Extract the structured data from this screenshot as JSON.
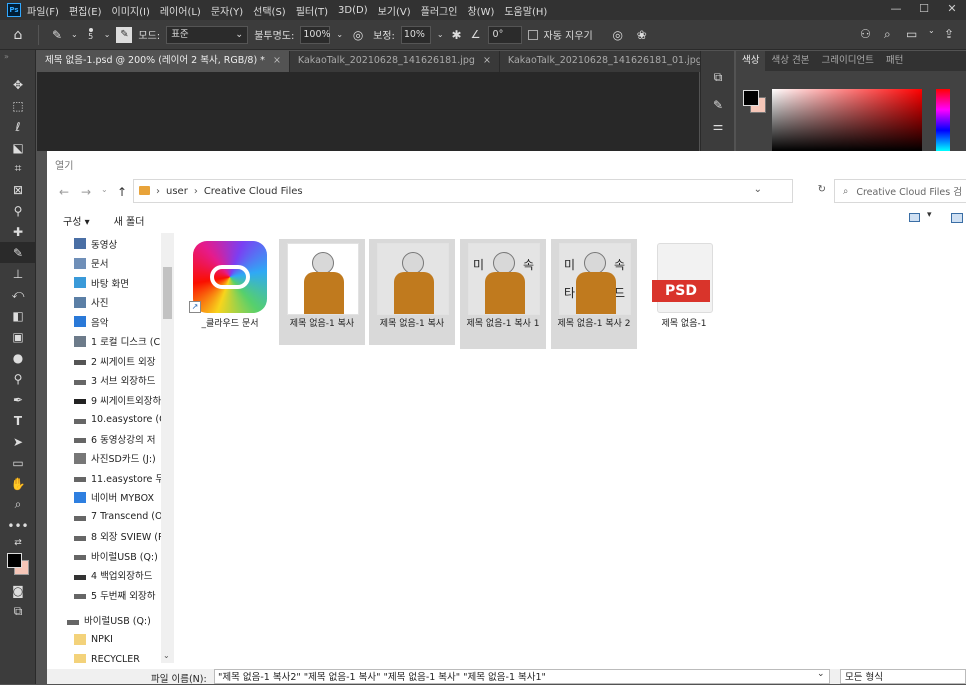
{
  "menubar": {
    "logo": "Ps",
    "items": [
      "파일(F)",
      "편집(E)",
      "이미지(I)",
      "레이어(L)",
      "문자(Y)",
      "선택(S)",
      "필터(T)",
      "3D(D)",
      "보기(V)",
      "플러그인",
      "창(W)",
      "도움말(H)"
    ]
  },
  "options": {
    "brush_size": "5",
    "mode_label": "모드:",
    "mode_value": "표준",
    "opacity_label": "불투명도:",
    "opacity_value": "100%",
    "smoothing_label": "보정:",
    "smoothing_value": "10%",
    "angle_value": "0°",
    "auto_erase_label": "자동 지우기"
  },
  "tabs": [
    {
      "label": "제목 없음-1.psd @ 200% (레이어 2 복사, RGB/8) *",
      "close": "×"
    },
    {
      "label": "KakaoTalk_20210628_141626181.jpg",
      "close": "×"
    },
    {
      "label": "KakaoTalk_20210628_141626181_01.jpg",
      "close": "×"
    }
  ],
  "color_panel": {
    "tabs": [
      "색상",
      "색상 견본",
      "그레이디언트",
      "패턴"
    ],
    "foreground": "#000000",
    "background": "#f5c6b8"
  },
  "dialog": {
    "title": "열기",
    "breadcrumb": [
      "user",
      "Creative Cloud Files"
    ],
    "search_placeholder": "Creative Cloud Files 검",
    "organize": "구성 ▾",
    "new_folder": "새 폴더",
    "nav_items": [
      "동영상",
      "문서",
      "바탕 화면",
      "사진",
      "음악",
      "1 로컬 디스크 (C",
      "2 씨게이트 외장",
      "3 서브 외장하드",
      "9 씨게이트외장하",
      "10.easystore (G:",
      "6 동영상강의 저",
      "사진SD카드 (J:)",
      "11.easystore 두",
      "네이버 MYBOX",
      "7 Transcend (O:",
      "8 외장 SVIEW (P",
      "바이럴USB (Q:)",
      "4 백업외장하드",
      "5 두번째 외장하",
      "바이럴USB (Q:)",
      "NPKI",
      "RECYCLER"
    ],
    "files": [
      {
        "label": "_클라우드 문서"
      },
      {
        "label": "제목 없음-1 복사"
      },
      {
        "label": "제목 없음-1 복사"
      },
      {
        "label": "제목 없음-1 복사 1"
      },
      {
        "label": "제목 없음-1 복사 2"
      },
      {
        "label": "제목 없음-1"
      }
    ],
    "psd_badge": "PSD",
    "thumb_text_4": [
      "미",
      "속"
    ],
    "thumb_text_5": [
      "미",
      "속",
      "타",
      "드"
    ],
    "filename_label": "파일 이름(N):",
    "filename_value": "\"제목 없음-1 복사2\" \"제목 없음-1 복사\" \"제목 없음-1 복사\" \"제목 없음-1 복사1\"",
    "filetype_value": "모든 형식"
  }
}
